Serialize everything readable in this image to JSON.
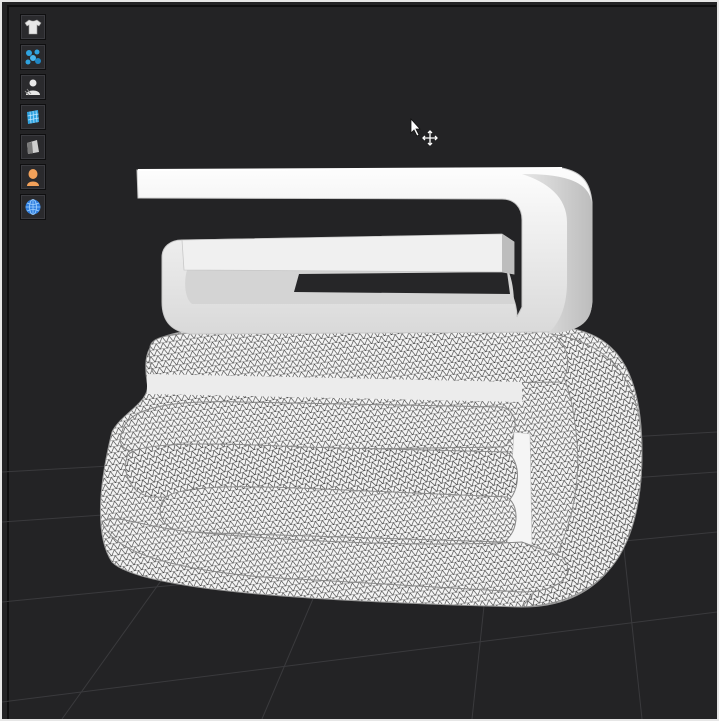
{
  "viewport": {
    "background": "#232325",
    "grid_color": "#3a3a3d",
    "model_color": "#f2f2f2",
    "mesh_color": "#1e1e1e"
  },
  "toolbar": {
    "items": [
      {
        "id": "garment",
        "icon": "tshirt-icon",
        "color": "#e8e8e8"
      },
      {
        "id": "particles",
        "icon": "particles-icon",
        "color": "#2fa3e0"
      },
      {
        "id": "avatar",
        "icon": "avatar-icon",
        "color": "#e8e8e8"
      },
      {
        "id": "pattern",
        "icon": "pattern-grid-icon",
        "color": "#2fa3e0"
      },
      {
        "id": "fabric",
        "icon": "fabric-swatch-icon",
        "color": "#cfcfcf"
      },
      {
        "id": "skin",
        "icon": "skin-avatar-icon",
        "color": "#f2a15a"
      },
      {
        "id": "environment",
        "icon": "globe-icon",
        "color": "#2f7fe0"
      }
    ]
  },
  "cursor": {
    "arrow_icon": "arrow-cursor-icon",
    "move_icon": "move-cursor-icon"
  }
}
